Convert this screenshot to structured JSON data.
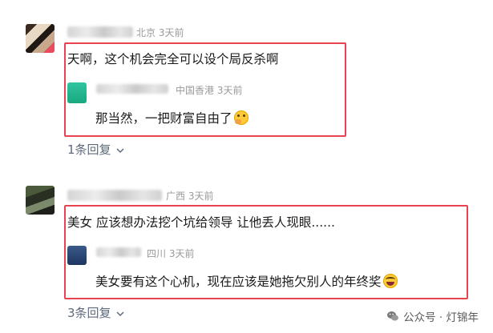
{
  "comments": [
    {
      "author_meta": "北京 3天前",
      "text": "天啊，这个机会完全可以设个局反杀啊",
      "reply": {
        "meta": "中国香港 3天前",
        "text": "那当然，一把财富自由了",
        "emoji": "thinking-face-icon"
      },
      "reply_count": "1条回复"
    },
    {
      "author_meta": "广西 3天前",
      "text": "美女 应该想办法挖个坑给领导 让他丢人现眼......",
      "reply": {
        "meta": "四川 3天前",
        "text": "美女要有这个心机，现在应该是她拖欠别人的年终奖",
        "emoji": "laughing-crying-face-icon"
      },
      "reply_count": "3条回复"
    }
  ],
  "watermark": "公众号 · 灯锦年",
  "colors": {
    "highlight_box": "#e8434f",
    "meta": "#9a9a9a",
    "reply_link": "#5e6a7c"
  }
}
